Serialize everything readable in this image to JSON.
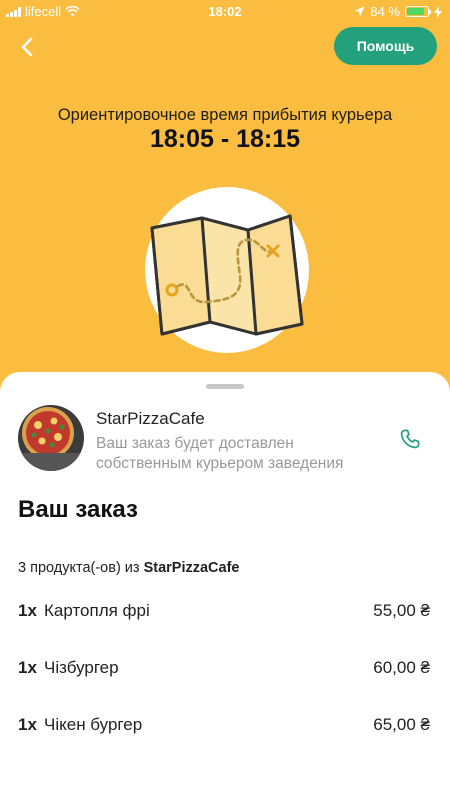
{
  "status_bar": {
    "carrier": "lifecell",
    "time": "18:02",
    "battery": "84 %",
    "battery_level": 0.84
  },
  "header": {
    "help_label": "Помощь"
  },
  "eta": {
    "label": "Ориентировочное время прибытия курьера",
    "time_range": "18:05 - 18:15"
  },
  "store": {
    "name": "StarPizzaCafe",
    "description": "Ваш заказ будет доставлен собственным курьером заведения"
  },
  "order": {
    "title": "Ваш заказ",
    "summary_prefix": "3 продукта(-ов) из ",
    "summary_store": "StarPizzaCafe",
    "items": [
      {
        "qty": "1x",
        "name": "Картопля фрі",
        "price": "55,00 ₴"
      },
      {
        "qty": "1x",
        "name": "Чізбургер",
        "price": "60,00 ₴"
      },
      {
        "qty": "1x",
        "name": "Чікен бургер",
        "price": "65,00 ₴"
      }
    ]
  },
  "colors": {
    "background": "#fbbd3f",
    "accent": "#23a07c"
  }
}
